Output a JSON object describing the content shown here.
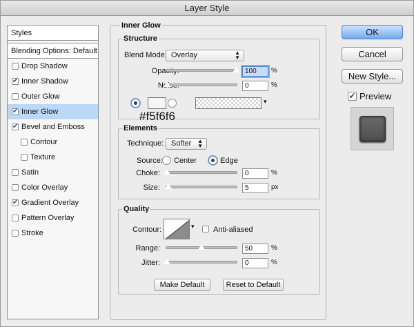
{
  "window": {
    "title": "Layer Style"
  },
  "styles_list": {
    "header": "Styles",
    "blending_options": "Blending Options: Default",
    "items": [
      {
        "label": "Drop Shadow",
        "checked": false,
        "selected": false,
        "sub": false
      },
      {
        "label": "Inner Shadow",
        "checked": true,
        "selected": false,
        "sub": false
      },
      {
        "label": "Outer Glow",
        "checked": false,
        "selected": false,
        "sub": false
      },
      {
        "label": "Inner Glow",
        "checked": true,
        "selected": true,
        "sub": false
      },
      {
        "label": "Bevel and Emboss",
        "checked": true,
        "selected": false,
        "sub": false
      },
      {
        "label": "Contour",
        "checked": false,
        "selected": false,
        "sub": true
      },
      {
        "label": "Texture",
        "checked": false,
        "selected": false,
        "sub": true
      },
      {
        "label": "Satin",
        "checked": false,
        "selected": false,
        "sub": false
      },
      {
        "label": "Color Overlay",
        "checked": false,
        "selected": false,
        "sub": false
      },
      {
        "label": "Gradient Overlay",
        "checked": true,
        "selected": false,
        "sub": false
      },
      {
        "label": "Pattern Overlay",
        "checked": false,
        "selected": false,
        "sub": false
      },
      {
        "label": "Stroke",
        "checked": false,
        "selected": false,
        "sub": false
      }
    ]
  },
  "panel": {
    "title": "Inner Glow",
    "structure": {
      "title": "Structure",
      "blend_mode_label": "Blend Mode:",
      "blend_mode_value": "Overlay",
      "opacity_label": "Opacity:",
      "opacity_value": "100",
      "opacity_level": 100,
      "noise_label": "Noise:",
      "noise_value": "0",
      "noise_level": 0,
      "percent": "%",
      "color_mode": "solid",
      "glow_color": "#f5f5f5",
      "glow_color_text": "#f5f6f6"
    },
    "elements": {
      "title": "Elements",
      "technique_label": "Technique:",
      "technique_value": "Softer",
      "source_label": "Source:",
      "source_center": "Center",
      "source_edge": "Edge",
      "source_selected": "edge",
      "choke_label": "Choke:",
      "choke_value": "0",
      "choke_level": 0,
      "size_label": "Size:",
      "size_value": "5",
      "size_level": 2,
      "percent": "%",
      "px": "px"
    },
    "quality": {
      "title": "Quality",
      "contour_label": "Contour:",
      "anti_aliased_label": "Anti-aliased",
      "anti_aliased_checked": false,
      "range_label": "Range:",
      "range_value": "50",
      "range_level": 50,
      "jitter_label": "Jitter:",
      "jitter_value": "0",
      "jitter_level": 0,
      "percent": "%"
    },
    "make_default": "Make Default",
    "reset_default": "Reset to Default"
  },
  "actions": {
    "ok": "OK",
    "cancel": "Cancel",
    "new_style": "New Style...",
    "preview_label": "Preview",
    "preview_checked": true
  }
}
